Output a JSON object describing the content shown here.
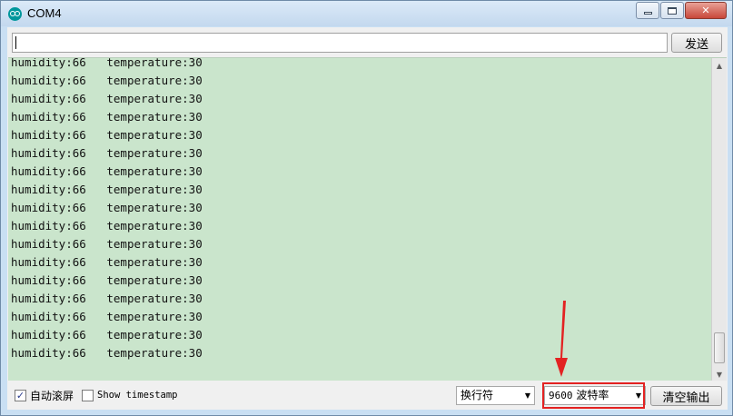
{
  "window": {
    "title": "COM4",
    "close_glyph": "✕"
  },
  "send_bar": {
    "input_value": "",
    "send_label": "发送"
  },
  "output_lines": [
    {
      "humidity": "humidity:66",
      "temperature": "temperature:30"
    },
    {
      "humidity": "humidity:66",
      "temperature": "temperature:30"
    },
    {
      "humidity": "humidity:66",
      "temperature": "temperature:30"
    },
    {
      "humidity": "humidity:66",
      "temperature": "temperature:30"
    },
    {
      "humidity": "humidity:66",
      "temperature": "temperature:30"
    },
    {
      "humidity": "humidity:66",
      "temperature": "temperature:30"
    },
    {
      "humidity": "humidity:66",
      "temperature": "temperature:30"
    },
    {
      "humidity": "humidity:66",
      "temperature": "temperature:30"
    },
    {
      "humidity": "humidity:66",
      "temperature": "temperature:30"
    },
    {
      "humidity": "humidity:66",
      "temperature": "temperature:30"
    },
    {
      "humidity": "humidity:66",
      "temperature": "temperature:30"
    },
    {
      "humidity": "humidity:66",
      "temperature": "temperature:30"
    },
    {
      "humidity": "humidity:66",
      "temperature": "temperature:30"
    },
    {
      "humidity": "humidity:66",
      "temperature": "temperature:30"
    },
    {
      "humidity": "humidity:66",
      "temperature": "temperature:30"
    },
    {
      "humidity": "humidity:66",
      "temperature": "temperature:30"
    },
    {
      "humidity": "humidity:66",
      "temperature": "temperature:30"
    }
  ],
  "bottom_bar": {
    "autoscroll": {
      "label": "自动滚屏",
      "checked": true,
      "check_glyph": "✓"
    },
    "timestamp": {
      "label": "Show timestamp",
      "checked": false
    },
    "line_ending": {
      "selected": "换行符"
    },
    "baud_rate": {
      "value": "9600",
      "unit_label": "波特率"
    },
    "clear_label": "清空输出"
  },
  "colors": {
    "output_background": "#cae5cc",
    "highlight": "#e32222",
    "arduino_teal": "#00979c"
  },
  "icons": {
    "app": "arduino-logo-icon",
    "minimize": "minimize-icon",
    "maximize": "maximize-icon",
    "close": "close-icon",
    "dropdown": "chevron-down-icon",
    "annotation": "red-arrow-icon"
  }
}
